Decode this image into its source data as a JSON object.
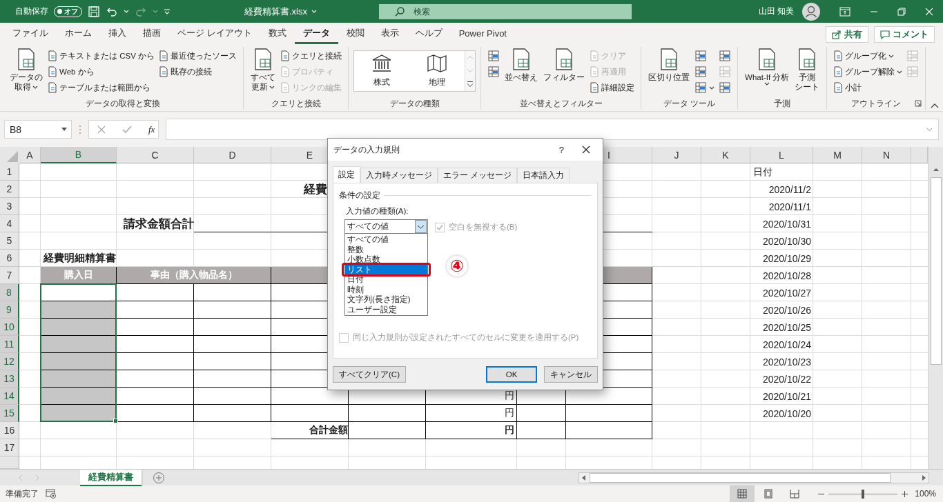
{
  "title_bar": {
    "autosave": {
      "label": "自動保存",
      "state": "オフ",
      "on": false
    },
    "file_name": "経費精算書.xlsx",
    "search": {
      "placeholder": "検索"
    },
    "user_name": "山田 知美"
  },
  "menu_tabs": [
    {
      "label": "ファイル",
      "selected": false
    },
    {
      "label": "ホーム",
      "selected": false
    },
    {
      "label": "挿入",
      "selected": false
    },
    {
      "label": "描画",
      "selected": false
    },
    {
      "label": "ページ レイアウト",
      "selected": false
    },
    {
      "label": "数式",
      "selected": false
    },
    {
      "label": "データ",
      "selected": true
    },
    {
      "label": "校閲",
      "selected": false
    },
    {
      "label": "表示",
      "selected": false
    },
    {
      "label": "ヘルプ",
      "selected": false
    },
    {
      "label": "Power Pivot",
      "selected": false
    }
  ],
  "share_button": "共有",
  "comment_button": "コメント",
  "ribbon": [
    {
      "label": "データの取得と変換",
      "launcher": false,
      "items": [
        {
          "kind": "large",
          "lines": [
            "データの",
            "取得"
          ],
          "dropdown": true,
          "disabled": false
        },
        {
          "kind": "small",
          "label": "テキストまたは CSV から",
          "dropdown": false,
          "disabled": false
        },
        {
          "kind": "small",
          "label": "Web から",
          "dropdown": false,
          "disabled": false
        },
        {
          "kind": "small",
          "label": "テーブルまたは範囲から",
          "dropdown": false,
          "disabled": false
        },
        {
          "kind": "small",
          "label": "最近使ったソース",
          "dropdown": false,
          "disabled": false
        },
        {
          "kind": "small",
          "label": "既存の接続",
          "dropdown": false,
          "disabled": false
        }
      ]
    },
    {
      "label": "クエリと接続",
      "launcher": false,
      "items": [
        {
          "kind": "large",
          "lines": [
            "すべて",
            "更新"
          ],
          "dropdown": true,
          "disabled": false
        },
        {
          "kind": "small",
          "label": "クエリと接続",
          "dropdown": false,
          "disabled": false
        },
        {
          "kind": "small",
          "label": "プロパティ",
          "dropdown": false,
          "disabled": true
        },
        {
          "kind": "small",
          "label": "リンクの編集",
          "dropdown": false,
          "disabled": true
        }
      ]
    },
    {
      "label": "データの種類",
      "launcher": false,
      "items": [
        {
          "kind": "gallery",
          "options": [
            "株式",
            "地理"
          ]
        }
      ]
    },
    {
      "label": "並べ替えとフィルター",
      "launcher": false,
      "items": [
        {
          "kind": "icon",
          "dropdown": false,
          "disabled": false
        },
        {
          "kind": "icon",
          "dropdown": false,
          "disabled": false
        },
        {
          "kind": "large",
          "lines": [
            "並べ替え"
          ],
          "dropdown": false,
          "disabled": false
        },
        {
          "kind": "large",
          "lines": [
            "フィルター"
          ],
          "dropdown": false,
          "disabled": false
        },
        {
          "kind": "small",
          "label": "クリア",
          "dropdown": false,
          "disabled": true
        },
        {
          "kind": "small",
          "label": "再適用",
          "dropdown": false,
          "disabled": true
        },
        {
          "kind": "small",
          "label": "詳細設定",
          "dropdown": false,
          "disabled": false
        }
      ]
    },
    {
      "label": "データ ツール",
      "launcher": false,
      "items": [
        {
          "kind": "large",
          "lines": [
            "区切り位置"
          ],
          "dropdown": false,
          "disabled": false
        },
        {
          "kind": "icon",
          "dropdown": false,
          "disabled": false
        },
        {
          "kind": "icon",
          "dropdown": false,
          "disabled": false
        },
        {
          "kind": "icon",
          "dropdown": true,
          "disabled": false
        },
        {
          "kind": "icon",
          "dropdown": false,
          "disabled": false
        },
        {
          "kind": "icon",
          "dropdown": false,
          "disabled": true
        },
        {
          "kind": "icon",
          "dropdown": false,
          "disabled": false
        }
      ]
    },
    {
      "label": "予測",
      "launcher": false,
      "items": [
        {
          "kind": "large",
          "lines": [
            "What-If 分析"
          ],
          "dropdown": true,
          "disabled": false
        },
        {
          "kind": "large",
          "lines": [
            "予測",
            "シート"
          ],
          "dropdown": false,
          "disabled": false
        }
      ]
    },
    {
      "label": "アウトライン",
      "launcher": true,
      "items": [
        {
          "kind": "small",
          "label": "グループ化",
          "dropdown": true,
          "disabled": false
        },
        {
          "kind": "small",
          "label": "グループ解除",
          "dropdown": true,
          "disabled": false
        },
        {
          "kind": "small",
          "label": "小計",
          "dropdown": false,
          "disabled": false
        },
        {
          "kind": "icon",
          "dropdown": false,
          "disabled": true
        },
        {
          "kind": "icon",
          "dropdown": false,
          "disabled": true
        }
      ]
    }
  ],
  "formula_bar": {
    "name_box": "B8",
    "fx": "fx"
  },
  "sheet": {
    "columns": {
      "A": {
        "label": "A",
        "selected": false
      },
      "B": {
        "label": "B",
        "selected": true
      },
      "C": {
        "label": "C",
        "selected": false
      },
      "D": {
        "label": "D",
        "selected": false
      },
      "E": {
        "label": "E",
        "selected": false
      },
      "I": {
        "label": "I",
        "selected": false
      },
      "J": {
        "label": "J",
        "selected": false
      },
      "K": {
        "label": "K",
        "selected": false
      },
      "L": {
        "label": "L",
        "selected": false
      },
      "M": {
        "label": "M",
        "selected": false
      },
      "N": {
        "label": "N",
        "selected": false
      }
    },
    "rows": [
      {
        "label": "1",
        "selected": false,
        "cells": {
          "L": {
            "kind": "text",
            "text": "日付"
          }
        }
      },
      {
        "label": "2",
        "selected": false,
        "cells": {
          "E": {
            "kind": "title",
            "text": "経費"
          },
          "L": {
            "kind": "date",
            "text": "2020/11/2"
          }
        }
      },
      {
        "label": "3",
        "selected": false,
        "cells": {
          "L": {
            "kind": "date",
            "text": "2020/11/1"
          }
        }
      },
      {
        "label": "4",
        "selected": false,
        "cells": {
          "C": {
            "kind": "heading",
            "text": "請求金額合計"
          },
          "L": {
            "kind": "date",
            "text": "2020/10/31"
          }
        }
      },
      {
        "label": "5",
        "selected": false,
        "cells": {
          "L": {
            "kind": "date",
            "text": "2020/10/30"
          }
        }
      },
      {
        "label": "6",
        "selected": false,
        "cells": {
          "B": {
            "kind": "subheading",
            "text": "経費明細精算書"
          },
          "L": {
            "kind": "date",
            "text": "2020/10/29"
          }
        }
      },
      {
        "label": "7",
        "selected": false,
        "cells": {
          "B": {
            "kind": "header",
            "text": "購入日"
          },
          "C": {
            "kind": "header-merged",
            "text": "事由（購入物品名）"
          },
          "E": {
            "kind": "header"
          },
          "I": {
            "kind": "header"
          },
          "L": {
            "kind": "date",
            "text": "2020/10/28"
          }
        }
      },
      {
        "label": "8",
        "selected": true,
        "cells": {
          "L": {
            "kind": "date",
            "text": "2020/10/27"
          }
        }
      },
      {
        "label": "9",
        "selected": true,
        "cells": {
          "B": {
            "kind": "shade"
          },
          "L": {
            "kind": "date",
            "text": "2020/10/26"
          }
        }
      },
      {
        "label": "10",
        "selected": true,
        "cells": {
          "B": {
            "kind": "shade"
          },
          "L": {
            "kind": "date",
            "text": "2020/10/25"
          }
        }
      },
      {
        "label": "11",
        "selected": true,
        "cells": {
          "B": {
            "kind": "shade"
          },
          "L": {
            "kind": "date",
            "text": "2020/10/24"
          }
        }
      },
      {
        "label": "12",
        "selected": true,
        "cells": {
          "B": {
            "kind": "shade"
          },
          "L": {
            "kind": "date",
            "text": "2020/10/23"
          }
        }
      },
      {
        "label": "13",
        "selected": true,
        "cells": {
          "B": {
            "kind": "shade"
          },
          "L": {
            "kind": "date",
            "text": "2020/10/22"
          }
        }
      },
      {
        "label": "14",
        "selected": true,
        "cells": {
          "B": {
            "kind": "shade"
          },
          "G": {
            "kind": "yen",
            "text": "円"
          },
          "L": {
            "kind": "date",
            "text": "2020/10/21"
          }
        }
      },
      {
        "label": "15",
        "selected": true,
        "cells": {
          "B": {
            "kind": "shade"
          },
          "G": {
            "kind": "yen",
            "text": "円"
          },
          "L": {
            "kind": "date",
            "text": "2020/10/20"
          }
        }
      },
      {
        "label": "16",
        "selected": false,
        "cells": {
          "E": {
            "kind": "total",
            "text": "合計金額"
          },
          "G": {
            "kind": "total-yen",
            "text": "円"
          }
        }
      },
      {
        "label": "17",
        "selected": false,
        "cells": {}
      }
    ]
  },
  "sheet_tabs": [
    {
      "label": "経費精算書",
      "selected": true
    }
  ],
  "status_bar": {
    "text": "準備完了",
    "views": [
      {
        "kind": "normal",
        "selected": true
      },
      {
        "kind": "page-layout",
        "selected": false
      },
      {
        "kind": "page-break",
        "selected": false
      }
    ],
    "zoom": {
      "level": 0.5
    },
    "zoom_text": "100%"
  },
  "dialog": {
    "title": "データの入力規則",
    "help": "?",
    "tabs": [
      {
        "label": "設定",
        "selected": true
      },
      {
        "label": "入力時メッセージ",
        "selected": false
      },
      {
        "label": "エラー メッセージ",
        "selected": false
      },
      {
        "label": "日本語入力",
        "selected": false
      }
    ],
    "section": "条件の設定",
    "type_label": "入力値の種類(A):",
    "type_value": "すべての値",
    "options": [
      {
        "label": "すべての値",
        "selected": false
      },
      {
        "label": "整数",
        "selected": false
      },
      {
        "label": "小数点数",
        "selected": false
      },
      {
        "label": "リスト",
        "selected": true
      },
      {
        "label": "日付",
        "selected": false
      },
      {
        "label": "時刻",
        "selected": false
      },
      {
        "label": "文字列(長さ指定)",
        "selected": false
      },
      {
        "label": "ユーザー設定",
        "selected": false
      }
    ],
    "ignore_blank": {
      "label": "空白を無視する(B)",
      "checked": true,
      "disabled": true
    },
    "apply_all": {
      "label": "同じ入力規則が設定されたすべてのセルに変更を適用する(P)",
      "checked": false,
      "disabled": true
    },
    "buttons": [
      {
        "label": "すべてクリア(C)",
        "default": false
      },
      {
        "label": "OK",
        "default": true
      },
      {
        "label": "キャンセル",
        "default": false
      }
    ],
    "annotation": "④"
  }
}
